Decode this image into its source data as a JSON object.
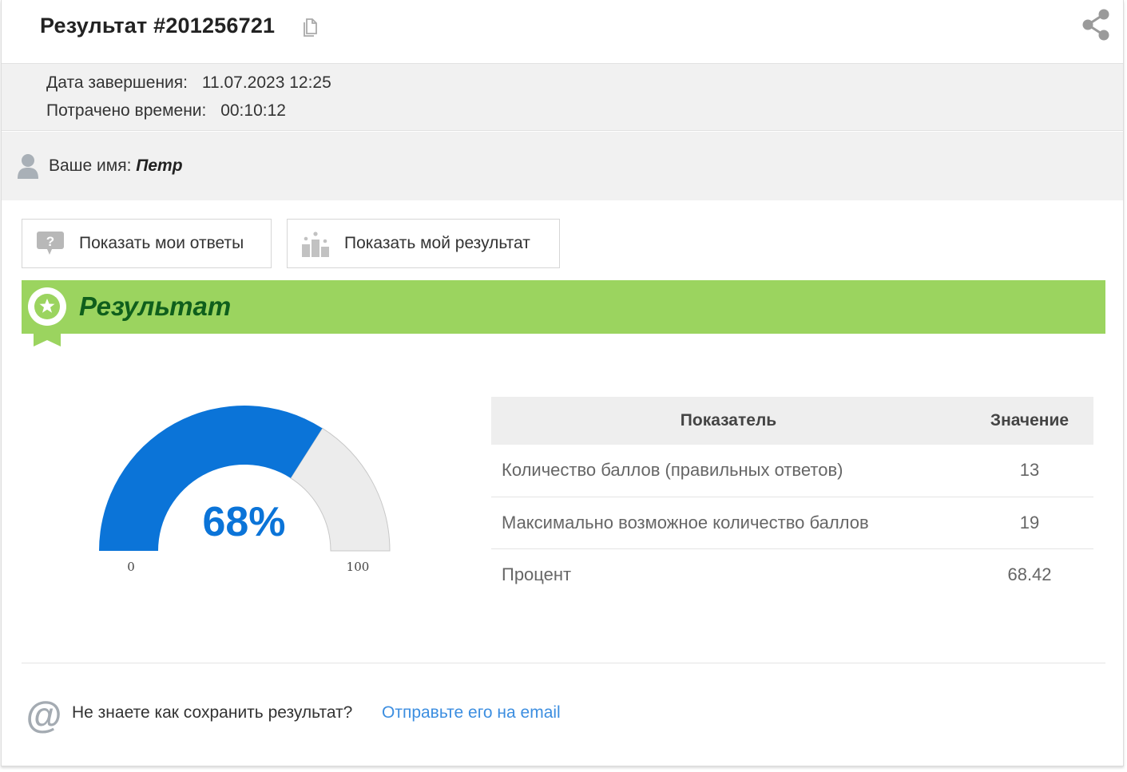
{
  "header": {
    "title": "Результат #201256721",
    "icons": {
      "copy": "copy-icon",
      "share": "share-icon"
    }
  },
  "meta": {
    "completion_label": "Дата завершения:",
    "completion_value": "11.07.2023 12:25",
    "time_label": "Потрачено времени:",
    "time_value": "00:10:12"
  },
  "user": {
    "name_label": "Ваше имя:",
    "name_value": "Петр",
    "icon": "user-icon"
  },
  "buttons": {
    "show_answers": "Показать мои ответы",
    "show_result": "Показать мой результат"
  },
  "result_section": {
    "title": "Результат",
    "color": "#9bd45f",
    "title_color": "#0f5f1c"
  },
  "gauge": {
    "value_percent": 68,
    "label": "68%",
    "min_label": "0",
    "max_label": "100",
    "fill_color": "#0b74d8",
    "track_color": "#ececec"
  },
  "stats_table": {
    "headers": [
      "Показатель",
      "Значение"
    ],
    "rows": [
      [
        "Количество баллов (правильных ответов)",
        "13"
      ],
      [
        "Максимально возможное количество баллов",
        "19"
      ],
      [
        "Процент",
        "68.42"
      ]
    ]
  },
  "footer": {
    "question": "Не знаете как сохранить результат?",
    "email_link": "Отправьте его на email",
    "icon": "at-icon"
  }
}
